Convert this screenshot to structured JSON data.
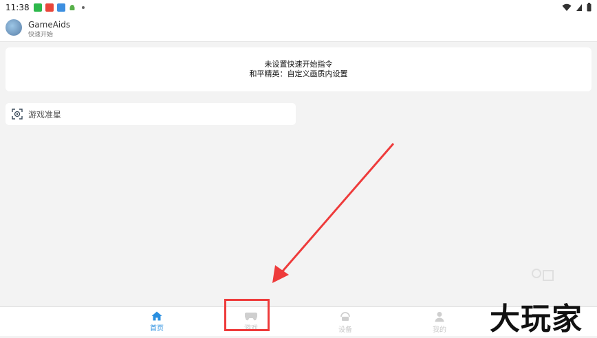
{
  "status_bar": {
    "time": "11:38",
    "notification_icons": [
      "green-app-icon",
      "red-app-icon",
      "blue-app-icon",
      "android-icon"
    ]
  },
  "app": {
    "name": "GameAids",
    "subtitle": "快速开始"
  },
  "quick_start": {
    "line1": "未设置快速开始指令",
    "line2": "和平精英：自定义画质内设置"
  },
  "crosshair": {
    "label": "游戏准星",
    "icon": "crosshair-icon"
  },
  "bottom_nav": [
    {
      "label": "首页",
      "icon": "home-icon",
      "active": true
    },
    {
      "label": "游戏",
      "icon": "gamepad-icon",
      "active": false
    },
    {
      "label": "设备",
      "icon": "device-icon",
      "active": false
    },
    {
      "label": "我的",
      "icon": "person-icon",
      "active": false
    }
  ],
  "watermark": "大玩家",
  "colors": {
    "accent": "#2a8fe0",
    "inactive": "#c9c9c9",
    "annotation_red": "#ee3b3b",
    "background": "#f3f3f3"
  }
}
